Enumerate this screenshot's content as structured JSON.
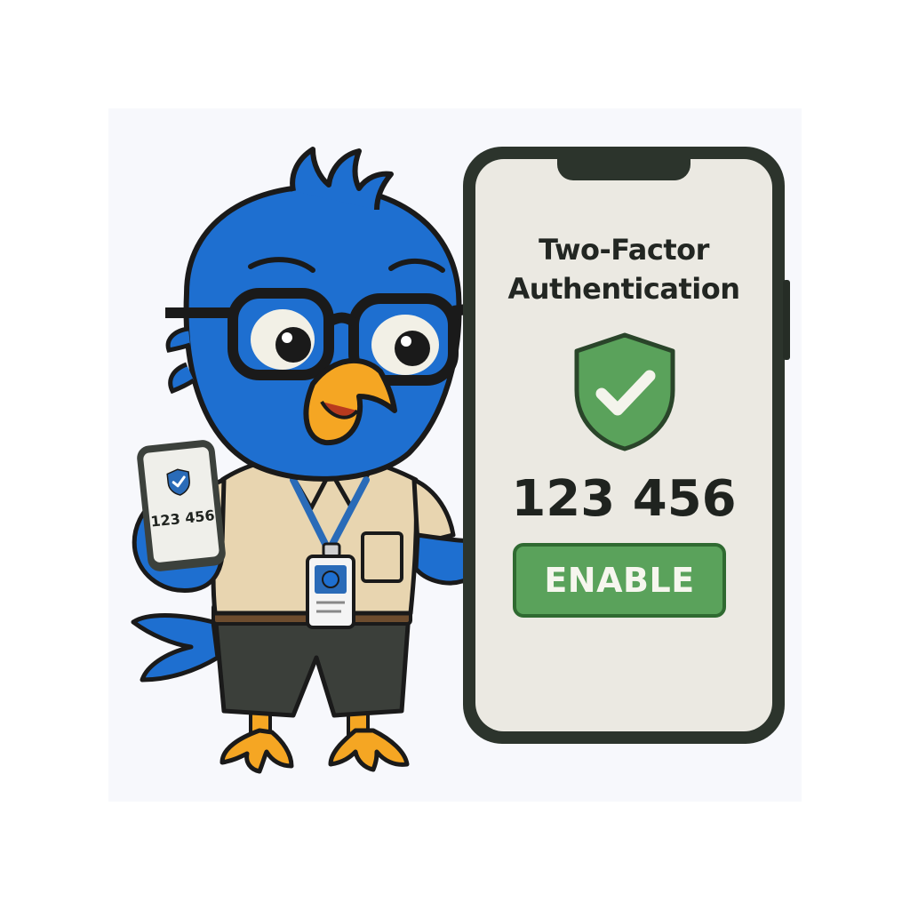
{
  "phone": {
    "title_line1": "Two-Factor",
    "title_line2": "Authentication",
    "icon": "shield-check-icon",
    "code": "123 456",
    "enable_label": "ENABLE"
  },
  "small_phone": {
    "icon": "shield-check-icon",
    "code": "123 456"
  },
  "mascot": {
    "character": "blue-bird-mascot",
    "badge_icon": "id-badge-icon"
  },
  "colors": {
    "accent_green": "#5aa25b",
    "bird_blue": "#1e6fd0",
    "beak_orange": "#f5a623",
    "phone_frame": "#2c342c",
    "screen_bg": "#ebe9e2"
  }
}
